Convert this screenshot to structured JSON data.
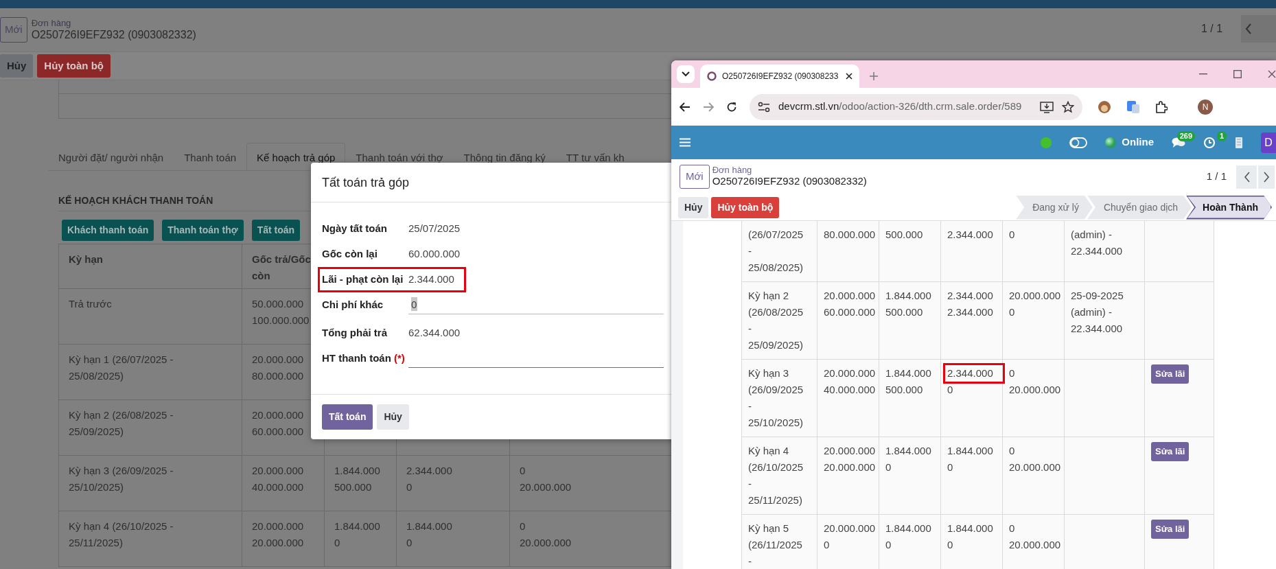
{
  "background_page": {
    "header": {
      "new_button": "Mới",
      "breadcrumb": "Đơn hàng",
      "record": "O250726I9EFZ932 (0903082332)",
      "pager": "1 / 1"
    },
    "actions": [
      {
        "label": "Hủy",
        "kind": "secondary"
      },
      {
        "label": "Hủy toàn bộ",
        "kind": "danger"
      }
    ],
    "tabs": [
      {
        "label": "Người đặt/ người nhận",
        "selected": false
      },
      {
        "label": "Thanh toán",
        "selected": false
      },
      {
        "label": "Kế hoạch trả góp",
        "selected": true
      },
      {
        "label": "Thanh toán với thợ",
        "selected": false
      },
      {
        "label": "Thông tin đăng ký",
        "selected": false
      },
      {
        "label": "TT tư vấn kh",
        "selected": false
      }
    ],
    "section_title": "KẾ HOẠCH KHÁCH THANH TOÁN",
    "buttons": [
      "Khách thanh toán",
      "Thanh toán thợ",
      "Tất toán"
    ],
    "table": {
      "columns": [
        "Kỳ hạn",
        "Gốc trả/Gốc còn"
      ],
      "rows": [
        [
          "Trả trước",
          "50.000.000\n100.000.000"
        ],
        [
          "Kỳ hạn 1 (26/07/2025 -\n25/08/2025)",
          "20.000.000\n80.000.000"
        ],
        [
          "Kỳ hạn 2 (26/08/2025 -\n25/09/2025)",
          "20.000.000\n60.000.000"
        ],
        [
          "Kỳ hạn 3 (26/09/2025 -\n25/10/2025)",
          "20.000.000\n40.000.000",
          "1.844.000\n500.000",
          "2.344.000\n0",
          "0\n20.000.000"
        ],
        [
          "Kỳ hạn 4 (26/10/2025 -\n25/11/2025)",
          "20.000.000\n20.000.000",
          "1.844.000\n0",
          "1.844.000\n0",
          "0\n20.000.000"
        ]
      ]
    }
  },
  "dialog": {
    "title": "Tất toán trả góp",
    "fields": [
      {
        "label": "Ngày tất toán",
        "kind": "text",
        "value": "25/07/2025",
        "highlighted": false
      },
      {
        "label": "Gốc còn lại",
        "kind": "text",
        "value": "60.000.000",
        "highlighted": false
      },
      {
        "label": "Lãi - phạt còn lại",
        "kind": "text",
        "value": "2.344.000",
        "highlighted": true
      },
      {
        "label": "Chi phí khác",
        "kind": "input",
        "value": "0",
        "highlighted": false
      },
      {
        "label": "Tổng phải trả",
        "kind": "text",
        "value": "62.344.000",
        "highlighted": false
      },
      {
        "label": "HT thanh toán",
        "required_mark": "(*)",
        "kind": "select",
        "highlighted": false
      }
    ],
    "buttons": [
      {
        "label": "Tất toán",
        "kind": "primary"
      },
      {
        "label": "Hủy",
        "kind": "secondary"
      }
    ]
  },
  "browser": {
    "tab_title": "O250726I9EFZ932 (090308233",
    "url_host": "devcrm.stl.vn",
    "url_path": "/odoo/action-326/dth.crm.sale.order/589",
    "profile": "N",
    "app": {
      "status_label": "Online",
      "messages_count": "269",
      "activities_count": "1",
      "avatar": "D",
      "header": {
        "new_button": "Mới",
        "breadcrumb": "Đơn hàng",
        "record": "O250726I9EFZ932 (0903082332)",
        "pager": "1 / 1"
      },
      "actions": [
        {
          "label": "Hủy",
          "kind": "secondary"
        },
        {
          "label": "Hủy toàn bộ",
          "kind": "danger"
        }
      ],
      "stages": [
        {
          "label": "Đang xử lý",
          "selected": false
        },
        {
          "label": "Chuyển giao dịch",
          "selected": false
        },
        {
          "label": "Hoàn Thành",
          "selected": true
        }
      ],
      "table": {
        "rows": [
          {
            "cells": [
              {
                "lines": [
                  "(26/07/2025",
                  "-",
                  "25/08/2025)"
                ],
                "highlighted": false
              },
              {
                "lines": [
                  "80.000.000"
                ],
                "highlighted": false
              },
              {
                "lines": [
                  "500.000"
                ],
                "highlighted": false
              },
              {
                "lines": [
                  "2.344.000"
                ],
                "highlighted": false
              },
              {
                "lines": [
                  "0"
                ],
                "highlighted": false
              },
              {
                "lines": [
                  "(admin) -",
                  "22.344.000"
                ],
                "highlighted": false
              },
              {
                "highlighted": false
              }
            ]
          },
          {
            "cells": [
              {
                "lines": [
                  "Kỳ hạn 2",
                  "(26/08/2025",
                  "-",
                  "25/09/2025)"
                ],
                "highlighted": false
              },
              {
                "lines": [
                  "20.000.000",
                  "60.000.000"
                ],
                "highlighted": false
              },
              {
                "lines": [
                  "1.844.000",
                  "500.000"
                ],
                "highlighted": false
              },
              {
                "lines": [
                  "2.344.000",
                  "2.344.000"
                ],
                "highlighted": false
              },
              {
                "lines": [
                  "20.000.000",
                  "0"
                ],
                "highlighted": false
              },
              {
                "lines": [
                  "25-09-2025",
                  "(admin) -",
                  "22.344.000"
                ],
                "highlighted": false
              },
              {
                "highlighted": false
              }
            ]
          },
          {
            "cells": [
              {
                "lines": [
                  "Kỳ hạn 3",
                  "(26/09/2025",
                  "-",
                  "25/10/2025)"
                ],
                "highlighted": false
              },
              {
                "lines": [
                  "20.000.000",
                  "40.000.000"
                ],
                "highlighted": false
              },
              {
                "lines": [
                  "1.844.000",
                  "500.000"
                ],
                "highlighted": false
              },
              {
                "lines": [
                  "2.344.000",
                  "0"
                ],
                "highlighted": true
              },
              {
                "lines": [
                  "0",
                  "20.000.000"
                ],
                "highlighted": false
              },
              {
                "highlighted": false
              },
              {
                "highlighted": false
              }
            ],
            "badge": "Sửa lãi"
          },
          {
            "cells": [
              {
                "lines": [
                  "Kỳ hạn 4",
                  "(26/10/2025",
                  "-",
                  "25/11/2025)"
                ],
                "highlighted": false
              },
              {
                "lines": [
                  "20.000.000",
                  "20.000.000"
                ],
                "highlighted": false
              },
              {
                "lines": [
                  "1.844.000",
                  "0"
                ],
                "highlighted": false
              },
              {
                "lines": [
                  "1.844.000",
                  "0"
                ],
                "highlighted": false
              },
              {
                "lines": [
                  "0",
                  "20.000.000"
                ],
                "highlighted": false
              },
              {
                "highlighted": false
              },
              {
                "highlighted": false
              }
            ],
            "badge": "Sửa lãi"
          },
          {
            "cells": [
              {
                "lines": [
                  "Kỳ hạn 5",
                  "(26/11/2025",
                  "-"
                ],
                "highlighted": false
              },
              {
                "lines": [
                  "20.000.000",
                  "0"
                ],
                "highlighted": false
              },
              {
                "lines": [
                  "1.844.000",
                  "0"
                ],
                "highlighted": false
              },
              {
                "lines": [
                  "1.844.000",
                  "0"
                ],
                "highlighted": false
              },
              {
                "lines": [
                  "0",
                  "20.000.000"
                ],
                "highlighted": false
              },
              {
                "highlighted": false
              },
              {
                "highlighted": false
              }
            ],
            "badge": "Sửa lãi"
          }
        ]
      }
    }
  }
}
